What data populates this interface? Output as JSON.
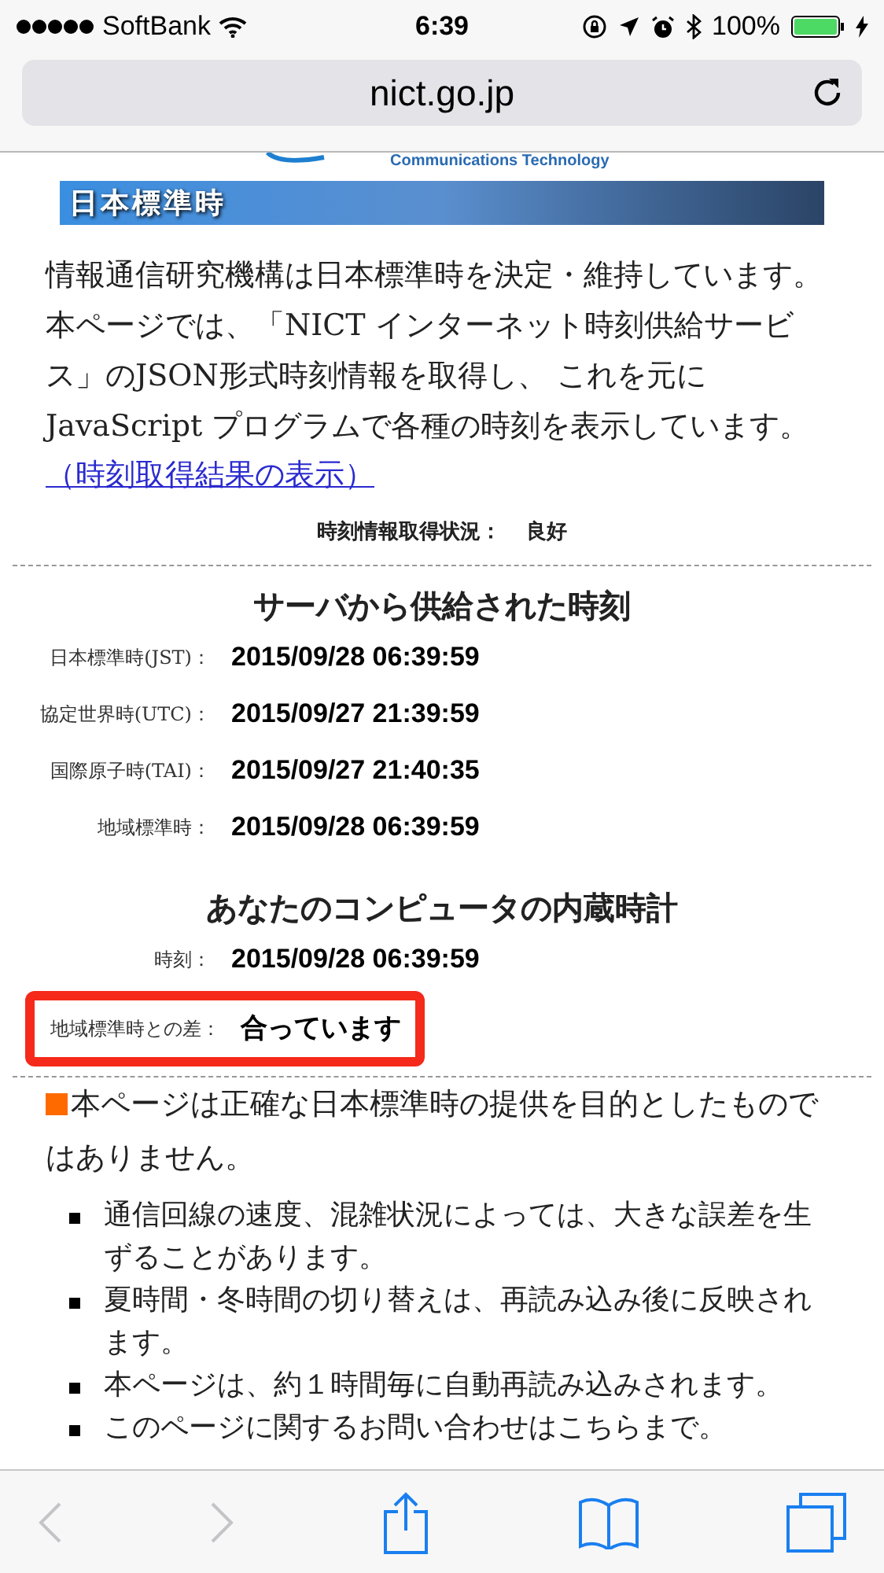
{
  "status_bar": {
    "carrier": "SoftBank",
    "time": "6:39",
    "battery": "100%"
  },
  "address_bar": {
    "url": "nict.go.jp"
  },
  "page": {
    "logo_text": "Communications Technology",
    "banner": "日本標準時",
    "intro": "情報通信研究機構は日本標準時を決定・維持しています。本ページでは、「NICT インターネット時刻供給サービス」のJSON形式時刻情報を取得し、 これを元に JavaScript プログラムで各種の時刻を表示しています。",
    "result_link": "（時刻取得結果の表示）",
    "fetch_status": {
      "label": "時刻情報取得状況：",
      "value": "良好"
    },
    "sections": [
      {
        "title": "サーバから供給された時刻",
        "rows": [
          {
            "label": "日本標準時(JST)：",
            "value": "2015/09/28 06:39:59",
            "highlighted": false
          },
          {
            "label": "協定世界時(UTC)：",
            "value": "2015/09/27 21:39:59",
            "highlighted": false
          },
          {
            "label": "国際原子時(TAI)：",
            "value": "2015/09/27 21:40:35",
            "highlighted": false
          },
          {
            "label": "地域標準時：",
            "value": "2015/09/28 06:39:59",
            "highlighted": false
          }
        ]
      },
      {
        "title": "あなたのコンピュータの内蔵時計",
        "rows": [
          {
            "label": "時刻：",
            "value": "2015/09/28 06:39:59",
            "highlighted": false
          },
          {
            "label": "地域標準時との差：",
            "value": "合っています",
            "highlighted": true
          }
        ]
      }
    ],
    "notice": "本ページは正確な日本標準時の提供を目的としたものではありません。",
    "bullets": [
      "通信回線の速度、混雑状況によっては、大きな誤差を生ずることがあります。",
      "夏時間・冬時間の切り替えは、再読み込み後に反映されます。",
      "本ページは、約１時間毎に自動再読み込みされます。",
      "このページに関するお問い合わせはこちらまで。"
    ]
  }
}
